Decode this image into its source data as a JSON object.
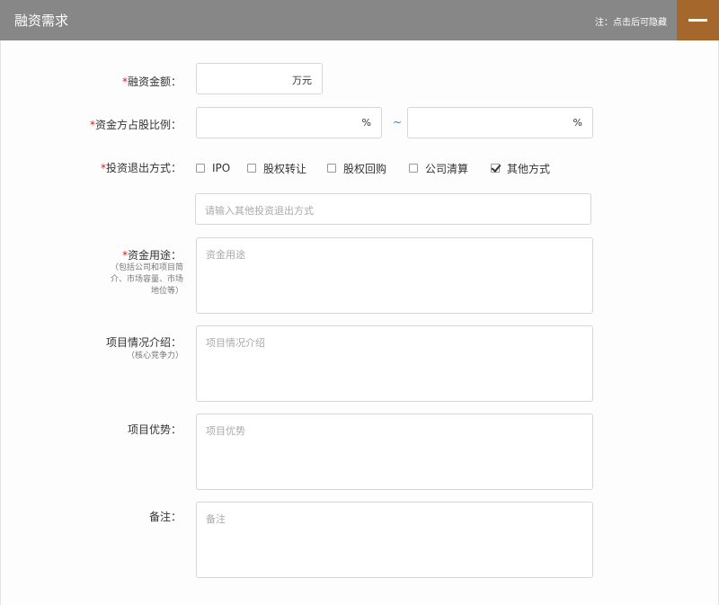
{
  "header": {
    "title": "融资需求",
    "note": "注：点击后可隐藏"
  },
  "form": {
    "required_mark": "*",
    "amount": {
      "label": "融资金额：",
      "unit": "万元",
      "value": ""
    },
    "ratio": {
      "label": "资金方占股比例：",
      "unit": "%",
      "separator": "~",
      "min": "",
      "max": ""
    },
    "exit": {
      "label": "投资退出方式：",
      "options": [
        {
          "label": "IPO",
          "checked": false
        },
        {
          "label": "股权转让",
          "checked": false
        },
        {
          "label": "股权回购",
          "checked": false
        },
        {
          "label": "公司清算",
          "checked": false
        },
        {
          "label": "其他方式",
          "checked": true
        }
      ],
      "other_placeholder": "请输入其他投资退出方式"
    },
    "usage": {
      "label": "资金用途：",
      "hint_lines": [
        "（包括公司和项目简",
        "介、市场容量、市场",
        "地位等）"
      ],
      "placeholder": "资金用途"
    },
    "intro": {
      "label": "项目情况介绍：",
      "hint": "（核心竞争力）",
      "placeholder": "项目情况介绍"
    },
    "advantage": {
      "label": "项目优势：",
      "placeholder": "项目优势"
    },
    "remark": {
      "label": "备注：",
      "placeholder": "备注"
    }
  }
}
